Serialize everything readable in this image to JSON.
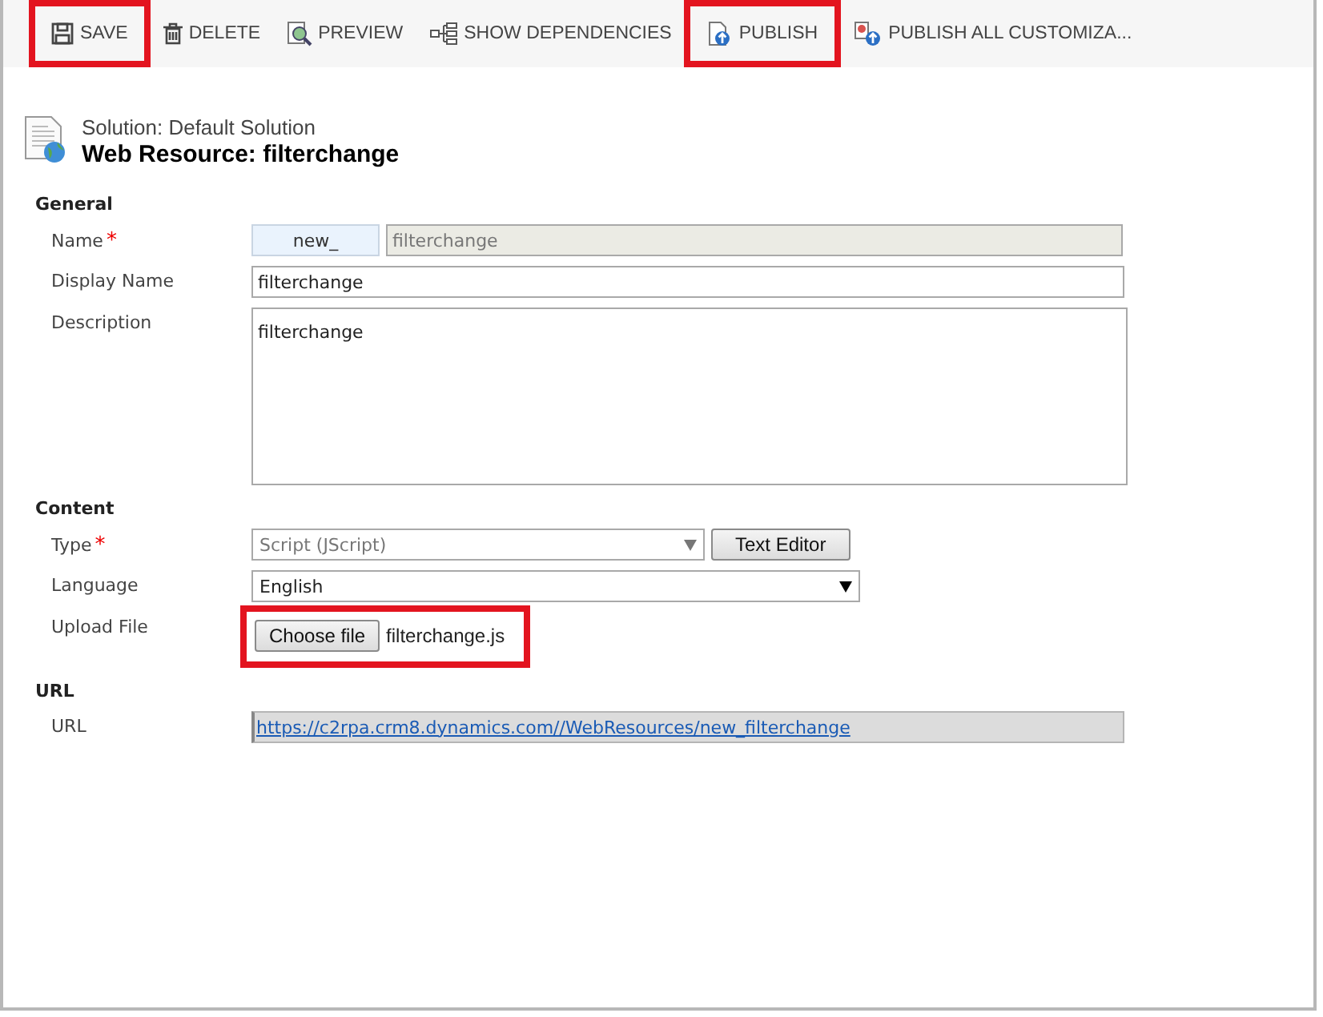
{
  "toolbar": [
    {
      "kind": "save",
      "label": "SAVE",
      "highlighted": true
    },
    {
      "kind": "delete",
      "label": "DELETE",
      "highlighted": false
    },
    {
      "kind": "preview",
      "label": "PREVIEW",
      "highlighted": false
    },
    {
      "kind": "dependencies",
      "label": "SHOW DEPENDENCIES",
      "highlighted": false
    },
    {
      "kind": "publish",
      "label": "PUBLISH",
      "highlighted": true
    },
    {
      "kind": "publish_all",
      "label": "PUBLISH ALL CUSTOMIZA..."
    }
  ],
  "header": {
    "solution": "Solution: Default Solution",
    "title": "Web Resource: filterchange"
  },
  "sections": [
    {
      "title": "General",
      "fields": [
        {
          "kind": "prefixed",
          "label": "Name",
          "required_mark": "*",
          "prefix": "new_",
          "value": "filterchange"
        },
        {
          "kind": "text",
          "label": "Display Name",
          "value": "filterchange"
        },
        {
          "kind": "textarea",
          "label": "Description",
          "value": "filterchange"
        }
      ]
    },
    {
      "title": "Content",
      "fields": [
        {
          "kind": "select",
          "label": "Type",
          "required_mark": "*",
          "value": "Script (JScript)",
          "disabled": true,
          "button": "Text Editor"
        },
        {
          "kind": "select",
          "label": "Language",
          "value": "English",
          "disabled": false
        },
        {
          "kind": "file",
          "label": "Upload File",
          "button": "Choose file",
          "value": "filterchange.js",
          "highlighted": true
        }
      ]
    },
    {
      "title": "URL",
      "fields": [
        {
          "kind": "link",
          "label": "URL",
          "value": "https://c2rpa.crm8.dynamics.com//WebResources/new_filterchange"
        }
      ]
    }
  ]
}
